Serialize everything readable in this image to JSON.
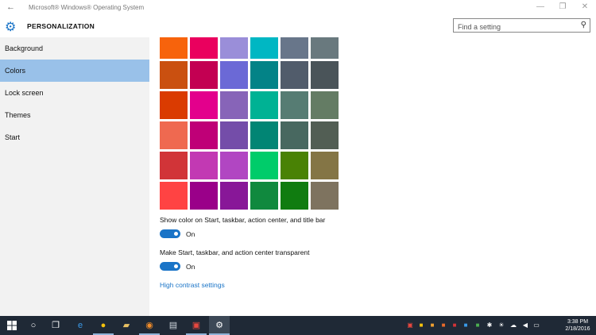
{
  "window": {
    "title": "Microsoft® Windows® Operating System",
    "back_icon": "back-arrow-icon",
    "controls": {
      "minimize": "—",
      "restore": "❐",
      "close": "✕"
    }
  },
  "header": {
    "title": "PERSONALIZATION",
    "search": {
      "placeholder": "Find a setting",
      "value": ""
    }
  },
  "sidebar": {
    "items": [
      {
        "label": "Background",
        "active": false
      },
      {
        "label": "Colors",
        "active": true
      },
      {
        "label": "Lock screen",
        "active": false
      },
      {
        "label": "Themes",
        "active": false
      },
      {
        "label": "Start",
        "active": false
      }
    ]
  },
  "accent_colors": [
    "#f7630c",
    "#ea005e",
    "#9a8ed9",
    "#00b7c3",
    "#68768a",
    "#69797e",
    "#ca5010",
    "#c30052",
    "#6b69d6",
    "#038387",
    "#515c6b",
    "#4a5459",
    "#da3b01",
    "#e3008c",
    "#8764b8",
    "#00b294",
    "#567c73",
    "#647c64",
    "#ef6950",
    "#bf0077",
    "#744da9",
    "#018574",
    "#486860",
    "#525e54",
    "#d13438",
    "#c239b3",
    "#b146c2",
    "#00cc6a",
    "#498205",
    "#847545",
    "#ff4343",
    "#9a0089",
    "#881798",
    "#10893e",
    "#107c10",
    "#7e735f"
  ],
  "settings": {
    "show_color": {
      "label": "Show color on Start, taskbar, action center, and title bar",
      "state": "On",
      "on": true
    },
    "transparent": {
      "label": "Make Start, taskbar, and action center transparent",
      "state": "On",
      "on": true
    },
    "high_contrast_link": "High contrast settings"
  },
  "taskbar": {
    "apps": [
      "start-icon",
      "cortana-icon",
      "task-view-icon",
      "edge-icon",
      "chrome-icon",
      "file-explorer-icon",
      "firefox-icon",
      "network-drive-icon",
      "calendar-app-icon",
      "settings-icon"
    ],
    "tray_icons": [
      "calendar-tray-icon",
      "sticky-note-icon",
      "onedrive-icon",
      "app-tray-icon",
      "pdf-icon",
      "security-icon",
      "keyboard-icon",
      "bluetooth-icon",
      "weather-icon",
      "cloud-icon",
      "volume-icon",
      "action-center-icon"
    ],
    "clock": {
      "time": "3:38 PM",
      "date": "2/18/2016"
    }
  },
  "colors": {
    "accent": "#1a74c7",
    "sidebar_active": "#99c1e9",
    "taskbar": "#1f2936"
  }
}
